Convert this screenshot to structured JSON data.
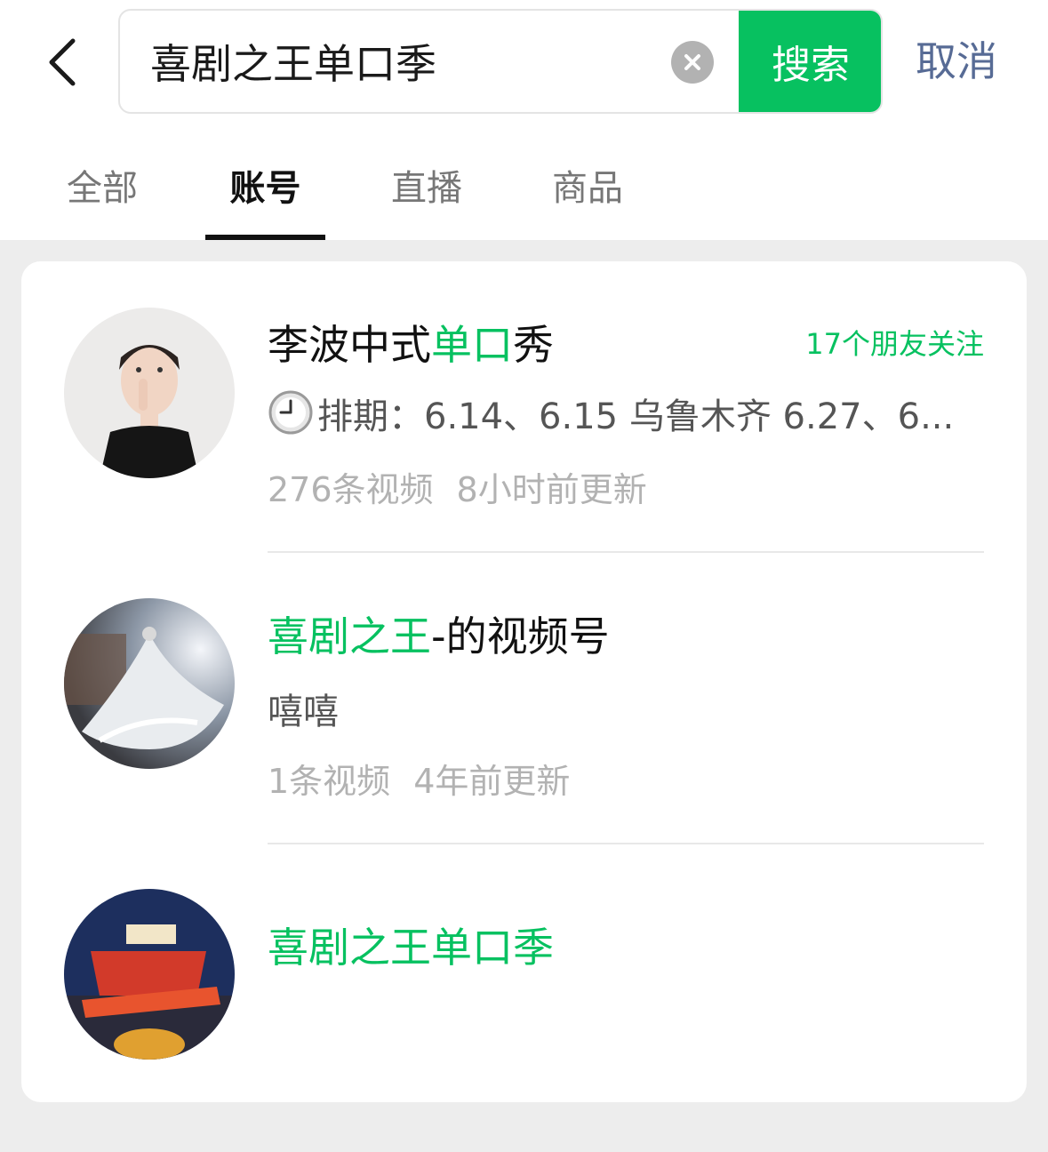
{
  "header": {
    "search_value": "喜剧之王单口季",
    "search_button": "搜索",
    "cancel_label": "取消"
  },
  "tabs": [
    {
      "label": "全部",
      "active": false
    },
    {
      "label": "账号",
      "active": true
    },
    {
      "label": "直播",
      "active": false
    },
    {
      "label": "商品",
      "active": false
    }
  ],
  "results": [
    {
      "title_pre": "李波中式",
      "title_hl": "单口",
      "title_post": "秀",
      "friends": "17个朋友关注",
      "desc": "排期：6.14、6.15 乌鲁木齐 6.27、6...",
      "video_count": "276条视频",
      "updated": "8小时前更新"
    },
    {
      "title_hl": "喜剧之王",
      "title_post": "-的视频号",
      "desc": "嘻嘻",
      "video_count": "1条视频",
      "updated": "4年前更新"
    },
    {
      "title_hl": "喜剧之王单口季"
    }
  ],
  "colors": {
    "accent": "#07c160",
    "link": "#576b95"
  }
}
